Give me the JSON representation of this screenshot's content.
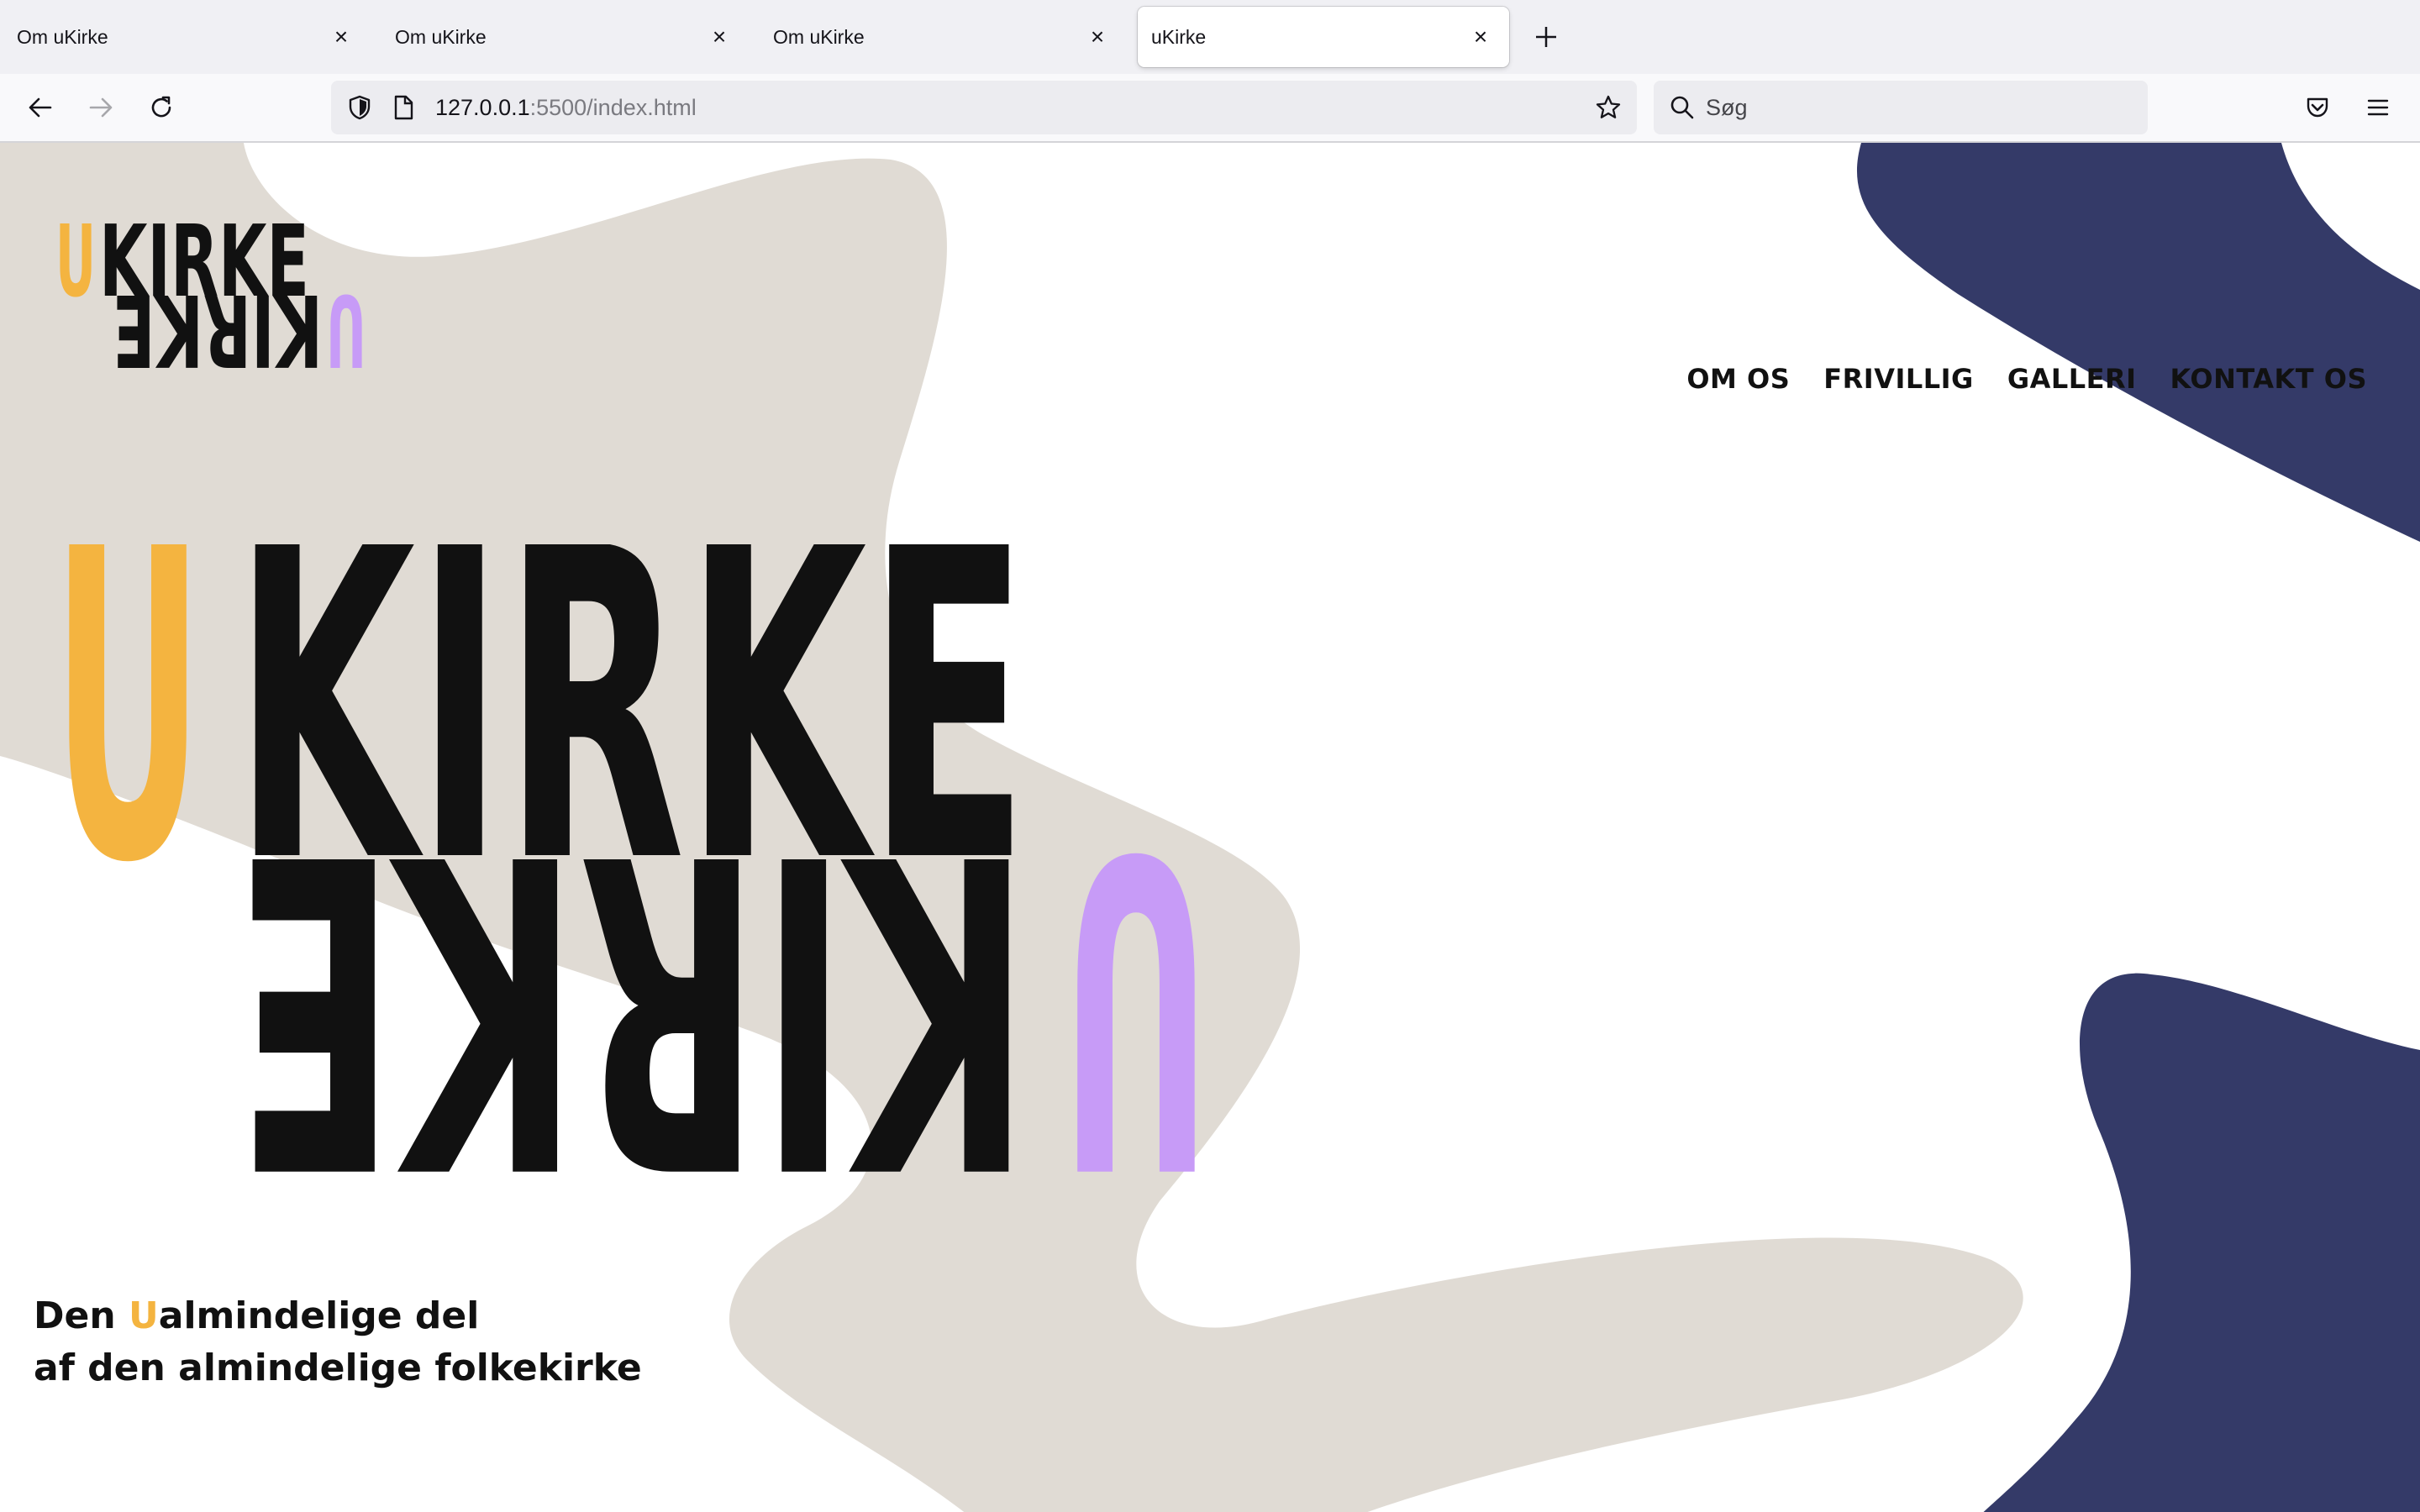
{
  "browser": {
    "tabs": [
      {
        "title": "Om uKirke",
        "active": false
      },
      {
        "title": "Om uKirke",
        "active": false
      },
      {
        "title": "Om uKirke",
        "active": false
      },
      {
        "title": "uKirke",
        "active": true
      }
    ],
    "url_host": "127.0.0.1",
    "url_rest": ":5500/index.html",
    "search_placeholder": "Søg"
  },
  "site": {
    "logo_letter": "U",
    "logo_word": "KIRKE",
    "nav": [
      "OM OS",
      "FRIVILLIG",
      "GALLERI",
      "KONTAKT OS"
    ],
    "tagline_line1_pre": "Den ",
    "tagline_line1_accent": "U",
    "tagline_line1_post": "almindelige del",
    "tagline_line2": "af den almindelige folkekirke"
  },
  "colors": {
    "yellow": "#f4b440",
    "purple": "#c79bf7",
    "navy": "#343a68",
    "beige": "#e0dbd4",
    "text": "#111111"
  }
}
